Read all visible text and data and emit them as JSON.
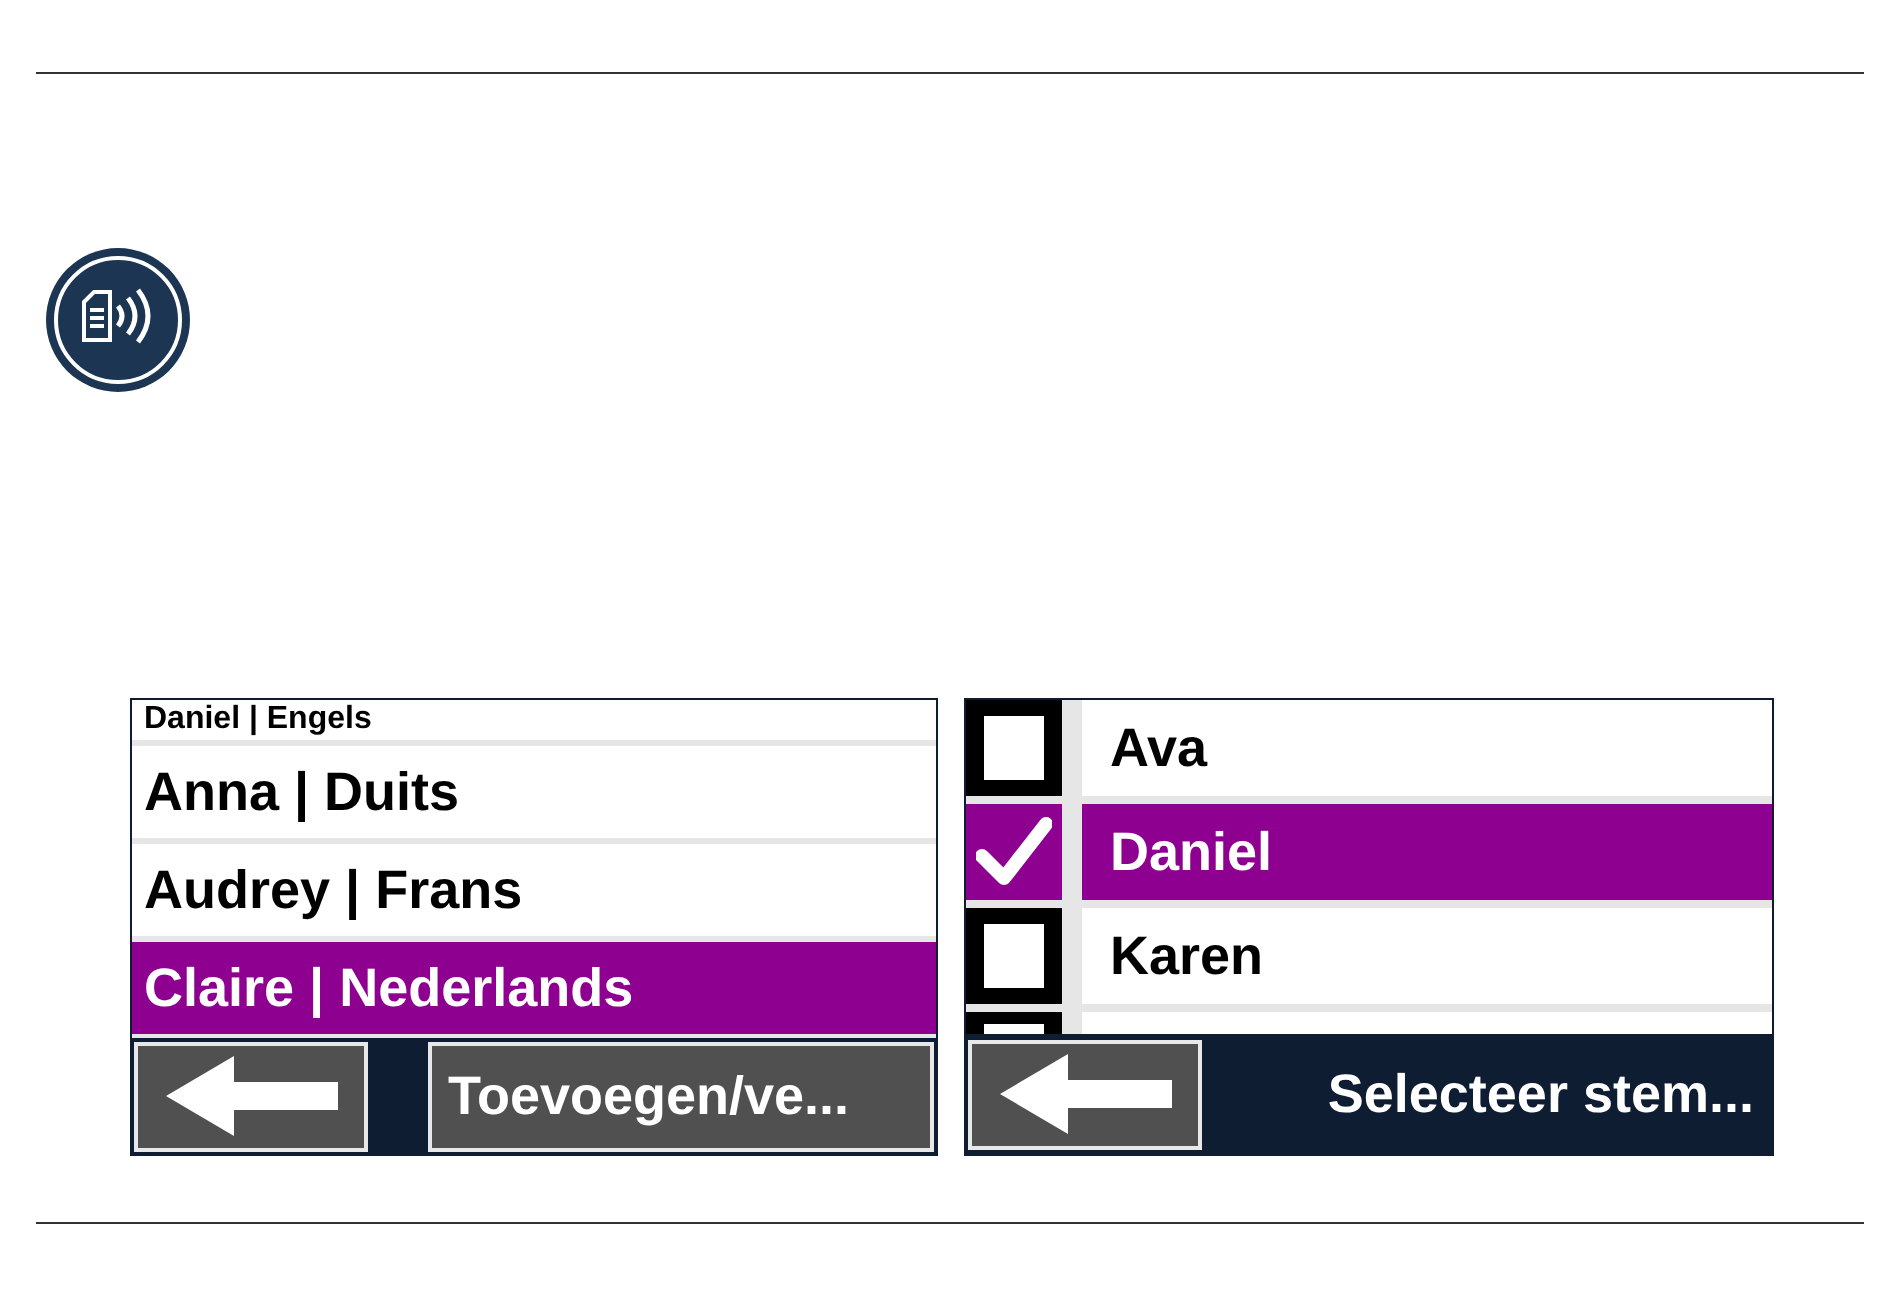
{
  "left_screen": {
    "items": [
      {
        "label": "Daniel | Engels",
        "selected": false
      },
      {
        "label": "Anna | Duits",
        "selected": false
      },
      {
        "label": "Audrey | Frans",
        "selected": false
      },
      {
        "label": "Claire | Nederlands",
        "selected": true
      }
    ],
    "action_button": "Toevoegen/ve..."
  },
  "right_screen": {
    "items": [
      {
        "label": "Ava",
        "checked": false,
        "selected": false
      },
      {
        "label": "Daniel",
        "checked": true,
        "selected": true
      },
      {
        "label": "Karen",
        "checked": false,
        "selected": false
      }
    ],
    "partial_row": {
      "checked": false
    },
    "title": "Selecteer stem..."
  }
}
